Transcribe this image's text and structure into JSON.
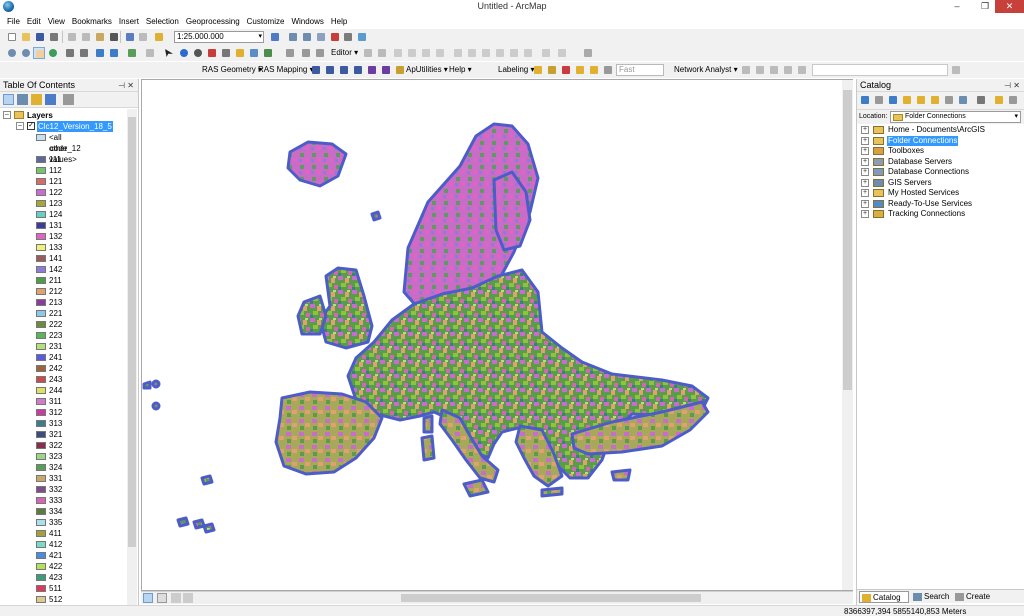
{
  "window": {
    "title": "Untitled - ArcMap",
    "minimize": "–",
    "maximize": "❐",
    "close": "✕"
  },
  "menu": [
    "File",
    "Edit",
    "View",
    "Bookmarks",
    "Insert",
    "Selection",
    "Geoprocessing",
    "Customize",
    "Windows",
    "Help"
  ],
  "toolbar": {
    "scale": "1:25.000.000",
    "editor": "Editor ▾",
    "ras_geometry": "RAS Geometry ▾",
    "ras_mapping": "RAS Mapping ▾",
    "ap_utilities": "ApUtilities ▾",
    "help": "Help ▾",
    "labeling": "Labeling ▾",
    "fast": "Fast",
    "network_analyst": "Network Analyst ▾"
  },
  "toc": {
    "title": "Table Of Contents",
    "root": "Layers",
    "layer": "Clc12_Version_18_5",
    "all_other": "<all other values>",
    "field": "code_12",
    "legend": [
      {
        "code": "111",
        "color": "#5a6a9a"
      },
      {
        "code": "112",
        "color": "#74c46c"
      },
      {
        "code": "121",
        "color": "#d46c6c"
      },
      {
        "code": "122",
        "color": "#c86cd0"
      },
      {
        "code": "123",
        "color": "#a6a63c"
      },
      {
        "code": "124",
        "color": "#66d0c0"
      },
      {
        "code": "131",
        "color": "#3c3c9c"
      },
      {
        "code": "132",
        "color": "#e064c4"
      },
      {
        "code": "133",
        "color": "#f0f07c"
      },
      {
        "code": "141",
        "color": "#9c5a5a"
      },
      {
        "code": "142",
        "color": "#8c7cd8"
      },
      {
        "code": "211",
        "color": "#4c9c4c"
      },
      {
        "code": "212",
        "color": "#e0a070"
      },
      {
        "code": "213",
        "color": "#8c3c9c"
      },
      {
        "code": "221",
        "color": "#8cc8e8"
      },
      {
        "code": "222",
        "color": "#6c8c3c"
      },
      {
        "code": "223",
        "color": "#5ab45a"
      },
      {
        "code": "231",
        "color": "#b4e07c"
      },
      {
        "code": "241",
        "color": "#5a5ae0"
      },
      {
        "code": "242",
        "color": "#a0643c"
      },
      {
        "code": "243",
        "color": "#c84c4c"
      },
      {
        "code": "244",
        "color": "#e0e064"
      },
      {
        "code": "311",
        "color": "#d07cc8"
      },
      {
        "code": "312",
        "color": "#c83ca0"
      },
      {
        "code": "313",
        "color": "#3c7c8c"
      },
      {
        "code": "321",
        "color": "#3c4c7c"
      },
      {
        "code": "322",
        "color": "#8c2c4c"
      },
      {
        "code": "323",
        "color": "#9cd48c"
      },
      {
        "code": "324",
        "color": "#5a9c5a"
      },
      {
        "code": "331",
        "color": "#c8a86c"
      },
      {
        "code": "332",
        "color": "#7c4c8c"
      },
      {
        "code": "333",
        "color": "#d864b4"
      },
      {
        "code": "334",
        "color": "#5a7c3c"
      },
      {
        "code": "335",
        "color": "#a8e0f0"
      },
      {
        "code": "411",
        "color": "#a0a03c"
      },
      {
        "code": "412",
        "color": "#7cd8c8"
      },
      {
        "code": "421",
        "color": "#4c8ce0"
      },
      {
        "code": "422",
        "color": "#b4e05a"
      },
      {
        "code": "423",
        "color": "#3c9c7c"
      },
      {
        "code": "511",
        "color": "#d83c5a"
      },
      {
        "code": "512",
        "color": "#e0c890"
      }
    ]
  },
  "catalog": {
    "title": "Catalog",
    "location_label": "Location:",
    "location_value": "Folder Connections",
    "items": [
      {
        "label": "Home - Documents\\ArcGIS",
        "selected": false,
        "color": "#e8c25a"
      },
      {
        "label": "Folder Connections",
        "selected": true,
        "color": "#e8c25a"
      },
      {
        "label": "Toolboxes",
        "selected": false,
        "color": "#d8a040"
      },
      {
        "label": "Database Servers",
        "selected": false,
        "color": "#8c9cb4"
      },
      {
        "label": "Database Connections",
        "selected": false,
        "color": "#7c9cc8"
      },
      {
        "label": "GIS Servers",
        "selected": false,
        "color": "#6c8cb0"
      },
      {
        "label": "My Hosted Services",
        "selected": false,
        "color": "#e8c25a"
      },
      {
        "label": "Ready-To-Use Services",
        "selected": false,
        "color": "#4c8cd0"
      },
      {
        "label": "Tracking Connections",
        "selected": false,
        "color": "#d8b040"
      }
    ],
    "tabs": [
      "Catalog",
      "Search",
      "Create Features"
    ]
  },
  "status": {
    "coordinates": "8366397,394  5855140,853 Meters"
  }
}
